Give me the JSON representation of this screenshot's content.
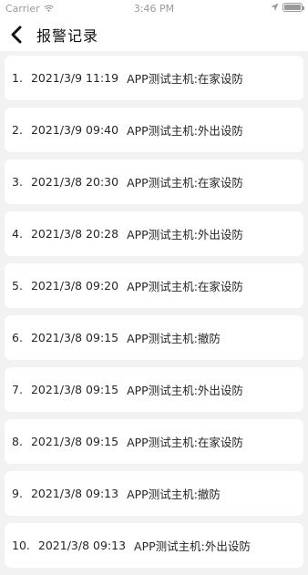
{
  "status_bar": {
    "carrier": "Carrier",
    "time": "3:46 PM",
    "battery_level": 1.0
  },
  "nav": {
    "title": "报警记录",
    "back_icon": "chevron-left-icon"
  },
  "records": [
    {
      "index": "1.",
      "datetime": "2021/3/9 11:19",
      "message": "APP测试主机:在家设防"
    },
    {
      "index": "2.",
      "datetime": "2021/3/9 09:40",
      "message": "APP测试主机:外出设防"
    },
    {
      "index": "3.",
      "datetime": "2021/3/8 20:30",
      "message": "APP测试主机:在家设防"
    },
    {
      "index": "4.",
      "datetime": "2021/3/8 20:28",
      "message": "APP测试主机:外出设防"
    },
    {
      "index": "5.",
      "datetime": "2021/3/8 09:20",
      "message": "APP测试主机:在家设防"
    },
    {
      "index": "6.",
      "datetime": "2021/3/8 09:15",
      "message": "APP测试主机:撤防"
    },
    {
      "index": "7.",
      "datetime": "2021/3/8 09:15",
      "message": "APP测试主机:外出设防"
    },
    {
      "index": "8.",
      "datetime": "2021/3/8 09:15",
      "message": "APP测试主机:在家设防"
    },
    {
      "index": "9.",
      "datetime": "2021/3/8 09:13",
      "message": "APP测试主机:撤防"
    },
    {
      "index": "10.",
      "datetime": "2021/3/8 09:13",
      "message": "APP测试主机:外出设防"
    }
  ]
}
